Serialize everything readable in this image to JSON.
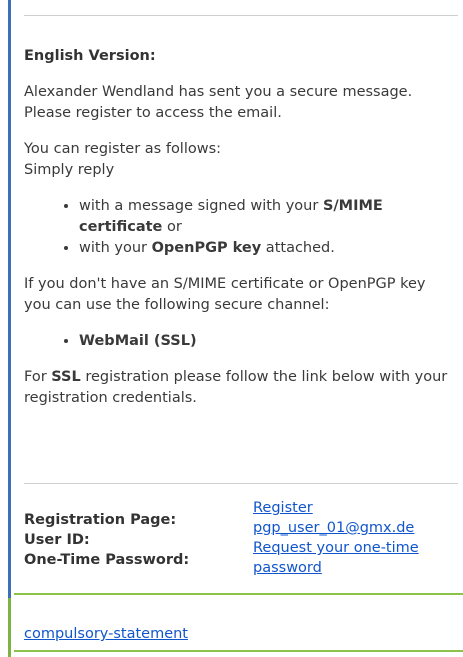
{
  "heading": "English Version:",
  "intro": {
    "line": "Alexander Wendland has sent you a secure message. Please register to access the email."
  },
  "register": {
    "line1": "You can register as follows:",
    "line2": "Simply reply"
  },
  "options": [
    {
      "pre": "with a message signed with your ",
      "bold": "S/MIME certificate",
      "post": " or"
    },
    {
      "pre": "with your ",
      "bold": "OpenPGP key",
      "post": " attached."
    }
  ],
  "no_cert": "If you don't have an S/MIME certificate or OpenPGP key you can use the following secure channel:",
  "channel": "WebMail (SSL)",
  "ssl": {
    "pre": "For ",
    "bold": "SSL",
    "post": " registration please follow the link below with your registration credentials."
  },
  "credentials": {
    "labels": {
      "registration_page": "Registration Page:",
      "user_id": "User ID:",
      "password": "One-Time Password:"
    },
    "values": {
      "register_link": "Register",
      "user_id": "pgp_user_01@gmx.de",
      "password_link": "Request your one-time password"
    }
  },
  "footer": {
    "statement_link": "compulsory-statement"
  },
  "colors": {
    "left_bar": "#3b6fb6",
    "green_rule": "#8bc34a",
    "link": "#1155cc"
  }
}
